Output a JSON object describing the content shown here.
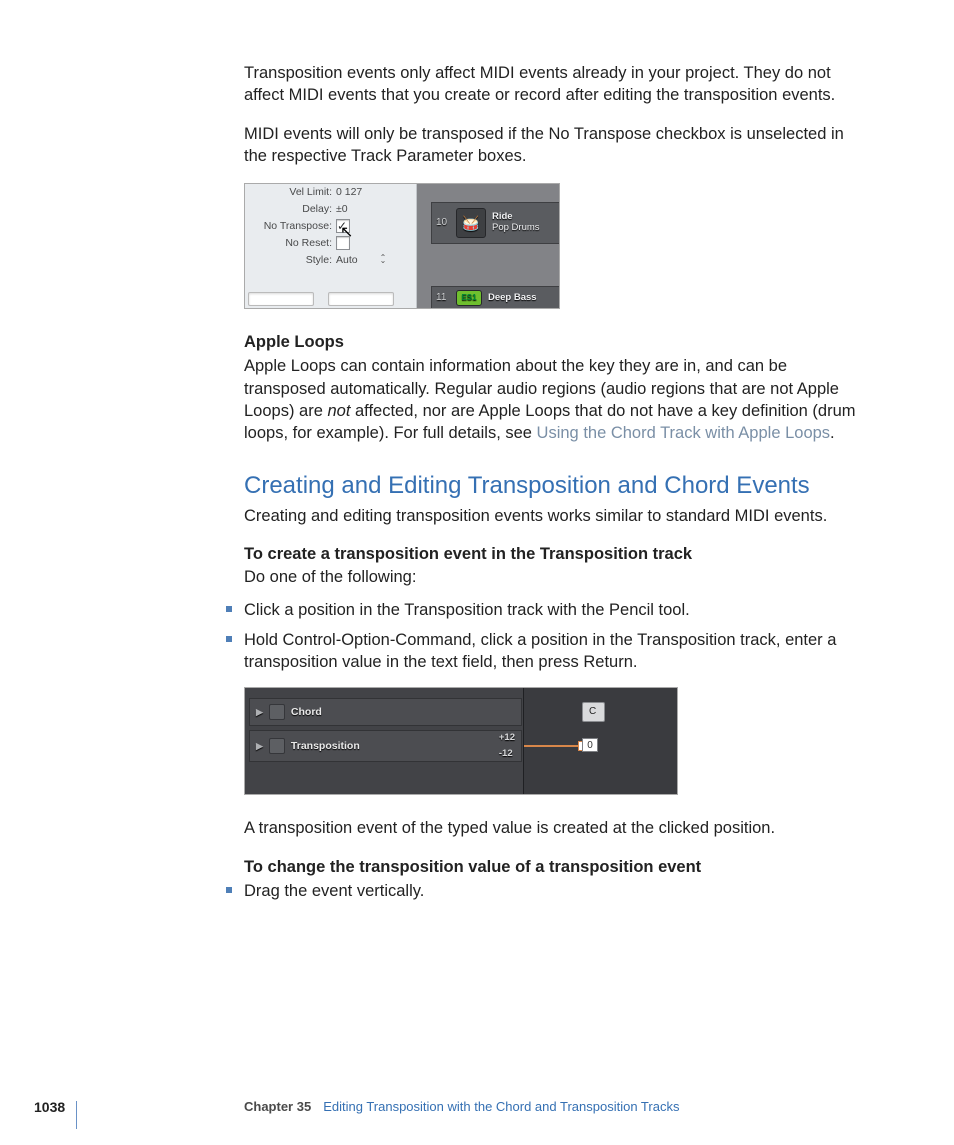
{
  "para1": "Transposition events only affect MIDI events already in your project. They do not affect MIDI events that you create or record after editing the transposition events.",
  "para2": "MIDI events will only be transposed if the No Transpose checkbox is unselected in the respective Track Parameter boxes.",
  "panel": {
    "vel_limit_label": "Vel Limit:",
    "vel_limit_value": "0      127",
    "delay_label": "Delay:",
    "delay_value": "±0",
    "no_transpose_label": "No Transpose:",
    "no_reset_label": "No Reset:",
    "style_label": "Style:",
    "style_value": "Auto"
  },
  "track1": {
    "num": "10",
    "title": "Ride",
    "subtitle": "Pop Drums"
  },
  "track2": {
    "num": "11",
    "title": "Deep Bass",
    "plugin": "ES1"
  },
  "apple_loops_heading": "Apple Loops",
  "apple_loops_text_a": "Apple Loops can contain information about the key they are in, and can be transposed automatically. Regular audio regions (audio regions that are not Apple Loops) are ",
  "apple_loops_not": "not",
  "apple_loops_text_b": " affected, nor are Apple Loops that do not have a key definition (drum loops, for example). For full details, see ",
  "apple_loops_link": "Using the Chord Track with Apple Loops",
  "period": ".",
  "h2": "Creating and Editing Transposition and Chord Events",
  "h2_sub": "Creating and editing transposition events works similar to standard MIDI events.",
  "proc1_title": "To create a transposition event in the Transposition track",
  "proc1_sub": "Do one of the following:",
  "bullet1": "Click a position in the Transposition track with the Pencil tool.",
  "bullet2": "Hold Control-Option-Command, click a position in the Transposition track, enter a transposition value in the text field, then press Return.",
  "fig2": {
    "chord": "Chord",
    "trans": "Transposition",
    "plus12": "+12",
    "minus12": "-12",
    "c": "C",
    "zero": "0"
  },
  "after_fig2": "A transposition event of the typed value is created at the clicked position.",
  "proc2_title": "To change the transposition value of a transposition event",
  "bullet3": "Drag the event vertically.",
  "footer": {
    "page": "1038",
    "chapter": "Chapter 35",
    "chapter_title": "Editing Transposition with the Chord and Transposition Tracks"
  }
}
